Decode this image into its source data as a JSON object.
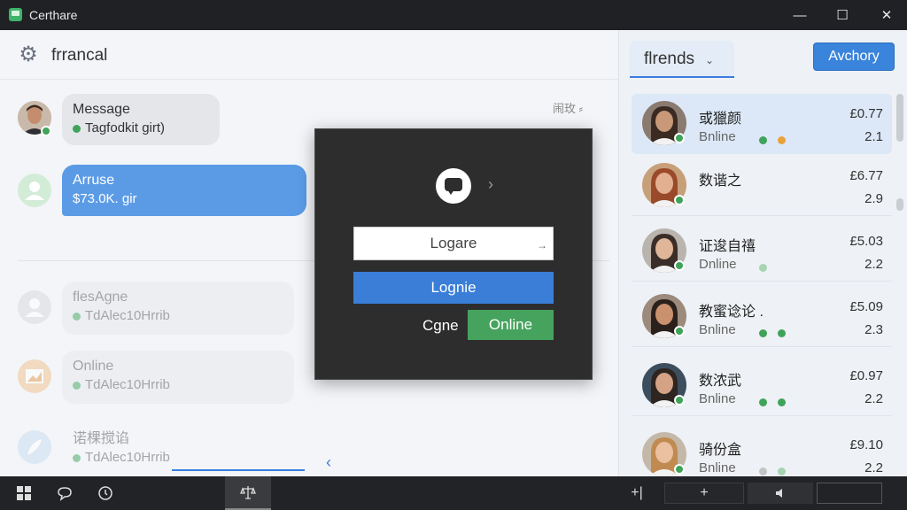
{
  "window": {
    "title": "Certhare",
    "min_icon": "minimize-icon",
    "max_icon": "maximize-icon",
    "close_icon": "close-icon"
  },
  "chat": {
    "title": "frrancal",
    "header_right": "闹玫  ⸗",
    "messages": [
      {
        "title": "Message",
        "subtitle": "Tagfodkit girt)",
        "style": "gray",
        "dot": "#3fa35a"
      },
      {
        "title": "Arruse",
        "subtitle": "$73.0K. gir",
        "style": "blue"
      },
      {
        "title": "flesAgne",
        "subtitle": "TdAlec10Hrrib",
        "style": "faded",
        "dot": "#3fa35a"
      },
      {
        "title": "Online",
        "subtitle": "TdAlec10Hrrib",
        "style": "faded",
        "dot": "#3fa35a"
      },
      {
        "title": "诺棵搅谄",
        "subtitle": "TdAlec10Hrrib",
        "style": "faded-plain",
        "dot": "#3fa35a"
      }
    ]
  },
  "dialog": {
    "input_value": "Logare",
    "primary_button": "Lognie",
    "label": "Cgne",
    "green_button": "Online"
  },
  "friends": {
    "tab_label": "flrends",
    "action_button": "Avchory",
    "items": [
      {
        "name": "或獵颜",
        "status": "Bnline",
        "price": "£0.77",
        "num": "2.1",
        "dots": [
          "#3fa35a",
          "#e8a23a"
        ],
        "selected": true,
        "skin": "#c89878",
        "hair": "#3a2a22",
        "bg": "#8a7a70"
      },
      {
        "name": "数谐之",
        "status": "",
        "price": "£6.77",
        "num": "2.9",
        "dots": [],
        "selected": false,
        "skin": "#e2b090",
        "hair": "#9a4a2a",
        "bg": "#c7a07a"
      },
      {
        "name": "证逡自禧",
        "status": "Dnline",
        "price": "£5.03",
        "num": "2.2",
        "dots": [
          "#a8d4b4"
        ],
        "selected": false,
        "skin": "#e0b698",
        "hair": "#3b2e28",
        "bg": "#b9b4ad"
      },
      {
        "name": "教蜜谂论 .",
        "status": "Bnline",
        "price": "£5.09",
        "num": "2.3",
        "dots": [
          "#3fa35a",
          "#3fa35a"
        ],
        "selected": false,
        "skin": "#c9916e",
        "hair": "#2b211c",
        "bg": "#9c8a7c"
      },
      {
        "name": "数浓武",
        "status": "Bnline",
        "price": "£0.97",
        "num": "2.2",
        "dots": [
          "#3fa35a",
          "#3fa35a"
        ],
        "selected": false,
        "skin": "#d4a386",
        "hair": "#2e2420",
        "bg": "#3d4e5e"
      },
      {
        "name": "骑份盒",
        "status": "Bnline",
        "price": "£9.10",
        "num": "2.2",
        "dots": [
          "#c4c4c4",
          "#a8d4b4"
        ],
        "selected": false,
        "skin": "#eac0a0",
        "hair": "#c08a50",
        "bg": "#c4b8a8"
      }
    ]
  },
  "taskbar": {
    "start_icon": "windows-start-icon",
    "chat_icon": "chat-icon",
    "clock_icon": "clock-icon",
    "active_icon": "scales-icon",
    "plus_label": "+|",
    "plus2_label": "+",
    "speaker_icon": "speaker-icon"
  }
}
